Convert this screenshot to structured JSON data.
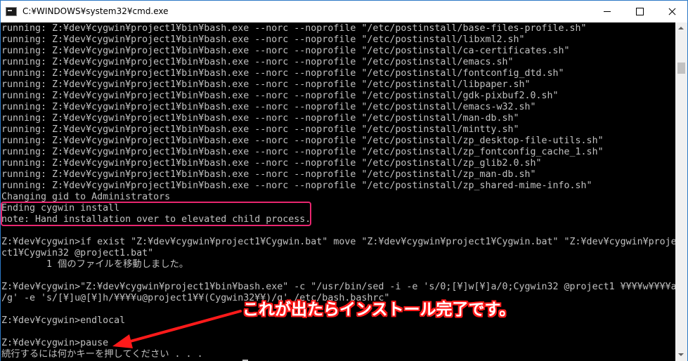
{
  "window": {
    "title": "C:¥WINDOWS¥system32¥cmd.exe",
    "controls": {
      "minimize": "minimize",
      "maximize": "maximize",
      "close": "close"
    }
  },
  "console": {
    "lines": [
      "running: Z:¥dev¥cygwin¥project1¥bin¥bash.exe --norc --noprofile \"/etc/postinstall/base-files-profile.sh\"",
      "running: Z:¥dev¥cygwin¥project1¥bin¥bash.exe --norc --noprofile \"/etc/postinstall/libxml2.sh\"",
      "running: Z:¥dev¥cygwin¥project1¥bin¥bash.exe --norc --noprofile \"/etc/postinstall/ca-certificates.sh\"",
      "running: Z:¥dev¥cygwin¥project1¥bin¥bash.exe --norc --noprofile \"/etc/postinstall/emacs.sh\"",
      "running: Z:¥dev¥cygwin¥project1¥bin¥bash.exe --norc --noprofile \"/etc/postinstall/fontconfig_dtd.sh\"",
      "running: Z:¥dev¥cygwin¥project1¥bin¥bash.exe --norc --noprofile \"/etc/postinstall/libpaper.sh\"",
      "running: Z:¥dev¥cygwin¥project1¥bin¥bash.exe --norc --noprofile \"/etc/postinstall/gdk-pixbuf2.0.sh\"",
      "running: Z:¥dev¥cygwin¥project1¥bin¥bash.exe --norc --noprofile \"/etc/postinstall/emacs-w32.sh\"",
      "running: Z:¥dev¥cygwin¥project1¥bin¥bash.exe --norc --noprofile \"/etc/postinstall/man-db.sh\"",
      "running: Z:¥dev¥cygwin¥project1¥bin¥bash.exe --norc --noprofile \"/etc/postinstall/mintty.sh\"",
      "running: Z:¥dev¥cygwin¥project1¥bin¥bash.exe --norc --noprofile \"/etc/postinstall/zp_desktop-file-utils.sh\"",
      "running: Z:¥dev¥cygwin¥project1¥bin¥bash.exe --norc --noprofile \"/etc/postinstall/zp_fontconfig_cache_1.sh\"",
      "running: Z:¥dev¥cygwin¥project1¥bin¥bash.exe --norc --noprofile \"/etc/postinstall/zp_glib2.0.sh\"",
      "running: Z:¥dev¥cygwin¥project1¥bin¥bash.exe --norc --noprofile \"/etc/postinstall/zp_man-db.sh\"",
      "running: Z:¥dev¥cygwin¥project1¥bin¥bash.exe --norc --noprofile \"/etc/postinstall/zp_shared-mime-info.sh\"",
      "Changing gid to Administrators",
      "Ending cygwin install",
      "note: Hand installation over to elevated child process.",
      "",
      "Z:¥dev¥cygwin>if exist \"Z:¥dev¥cygwin¥project1¥Cygwin.bat\" move \"Z:¥dev¥cygwin¥project1¥Cygwin.bat\" \"Z:¥dev¥cygwin¥proje",
      "ct1¥Cygwin32 @project1.bat\"",
      "        1 個のファイルを移動しました。",
      "",
      "Z:¥dev¥cygwin>\"Z:¥dev¥cygwin¥project1¥bin¥bash.exe\" -c \"/usr/bin/sed -i -e 's/0;[¥]w[¥]a/0;Cygwin32 @project1 ¥¥¥¥w¥¥¥¥a",
      "/g' -e 's/[¥]u@[¥]h/¥¥¥¥u@project1¥¥(Cygwin32¥¥)/g' /etc/bash.bashrc\"",
      "",
      "Z:¥dev¥cygwin>endlocal",
      "",
      "Z:¥dev¥cygwin>pause",
      "続行するには何かキーを押してください . . ."
    ]
  },
  "annotation": {
    "callout": "これが出たらインストール完了です。",
    "highlight_color": "#e8266f",
    "arrow_color": "#ff1a1a"
  },
  "colors": {
    "console_text": "#c0c0c0",
    "console_bg": "#000000",
    "callout_text": "#ffffff"
  }
}
